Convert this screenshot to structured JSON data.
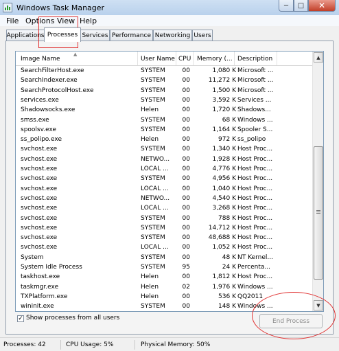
{
  "window": {
    "title": "Windows Task Manager"
  },
  "menu": [
    "File",
    "Options",
    "View",
    "Help"
  ],
  "tabs": [
    "Applications",
    "Processes",
    "Services",
    "Performance",
    "Networking",
    "Users"
  ],
  "columns": [
    "Image Name",
    "User Name",
    "CPU",
    "Memory (...",
    "Description"
  ],
  "processes": [
    {
      "name": "SearchFilterHost.exe",
      "user": "SYSTEM",
      "cpu": "00",
      "mem": "1,080 K",
      "desc": "Microsoft ..."
    },
    {
      "name": "SearchIndexer.exe",
      "user": "SYSTEM",
      "cpu": "00",
      "mem": "11,272 K",
      "desc": "Microsoft ..."
    },
    {
      "name": "SearchProtocolHost.exe",
      "user": "SYSTEM",
      "cpu": "00",
      "mem": "1,500 K",
      "desc": "Microsoft ..."
    },
    {
      "name": "services.exe",
      "user": "SYSTEM",
      "cpu": "00",
      "mem": "3,592 K",
      "desc": "Services ..."
    },
    {
      "name": "Shadowsocks.exe",
      "user": "Helen",
      "cpu": "00",
      "mem": "1,720 K",
      "desc": "Shadows..."
    },
    {
      "name": "smss.exe",
      "user": "SYSTEM",
      "cpu": "00",
      "mem": "68 K",
      "desc": "Windows ..."
    },
    {
      "name": "spoolsv.exe",
      "user": "SYSTEM",
      "cpu": "00",
      "mem": "1,164 K",
      "desc": "Spooler S..."
    },
    {
      "name": "ss_polipo.exe",
      "user": "Helen",
      "cpu": "00",
      "mem": "972 K",
      "desc": "ss_polipo"
    },
    {
      "name": "svchost.exe",
      "user": "SYSTEM",
      "cpu": "00",
      "mem": "1,340 K",
      "desc": "Host Proc..."
    },
    {
      "name": "svchost.exe",
      "user": "NETWO...",
      "cpu": "00",
      "mem": "1,928 K",
      "desc": "Host Proc..."
    },
    {
      "name": "svchost.exe",
      "user": "LOCAL ...",
      "cpu": "00",
      "mem": "4,776 K",
      "desc": "Host Proc..."
    },
    {
      "name": "svchost.exe",
      "user": "SYSTEM",
      "cpu": "00",
      "mem": "4,956 K",
      "desc": "Host Proc..."
    },
    {
      "name": "svchost.exe",
      "user": "LOCAL ...",
      "cpu": "00",
      "mem": "1,040 K",
      "desc": "Host Proc..."
    },
    {
      "name": "svchost.exe",
      "user": "NETWO...",
      "cpu": "00",
      "mem": "4,540 K",
      "desc": "Host Proc..."
    },
    {
      "name": "svchost.exe",
      "user": "LOCAL ...",
      "cpu": "00",
      "mem": "3,268 K",
      "desc": "Host Proc..."
    },
    {
      "name": "svchost.exe",
      "user": "SYSTEM",
      "cpu": "00",
      "mem": "788 K",
      "desc": "Host Proc..."
    },
    {
      "name": "svchost.exe",
      "user": "SYSTEM",
      "cpu": "00",
      "mem": "14,712 K",
      "desc": "Host Proc..."
    },
    {
      "name": "svchost.exe",
      "user": "SYSTEM",
      "cpu": "00",
      "mem": "48,688 K",
      "desc": "Host Proc..."
    },
    {
      "name": "svchost.exe",
      "user": "LOCAL ...",
      "cpu": "00",
      "mem": "1,052 K",
      "desc": "Host Proc..."
    },
    {
      "name": "System",
      "user": "SYSTEM",
      "cpu": "00",
      "mem": "48 K",
      "desc": "NT Kernel..."
    },
    {
      "name": "System Idle Process",
      "user": "SYSTEM",
      "cpu": "95",
      "mem": "24 K",
      "desc": "Percenta..."
    },
    {
      "name": "taskhost.exe",
      "user": "Helen",
      "cpu": "00",
      "mem": "1,812 K",
      "desc": "Host Proc..."
    },
    {
      "name": "taskmgr.exe",
      "user": "Helen",
      "cpu": "02",
      "mem": "1,976 K",
      "desc": "Windows ..."
    },
    {
      "name": "TXPlatform.exe",
      "user": "Helen",
      "cpu": "00",
      "mem": "536 K",
      "desc": "QQ2011"
    },
    {
      "name": "wininit.exe",
      "user": "SYSTEM",
      "cpu": "00",
      "mem": "148 K",
      "desc": "Windows ..."
    }
  ],
  "show_all_label": "Show processes from all users",
  "show_all_checked": true,
  "end_process_label": "End Process",
  "status": {
    "processes": "Processes: 42",
    "cpu": "CPU Usage: 5%",
    "memory": "Physical Memory: 50%"
  },
  "annotation_color": "#e03030"
}
